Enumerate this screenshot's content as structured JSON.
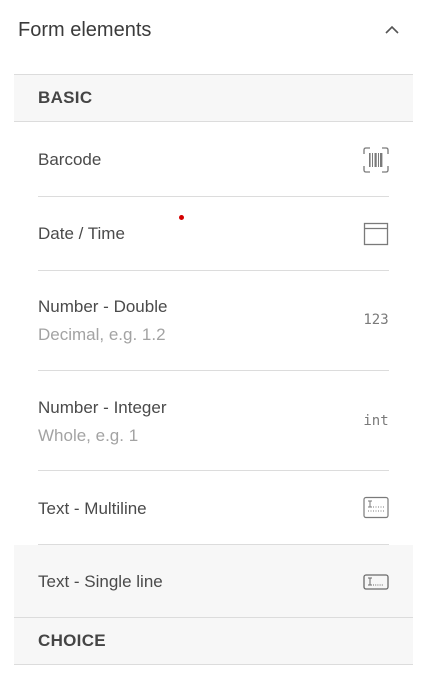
{
  "panel": {
    "title": "Form elements"
  },
  "sections": {
    "basic": "BASIC",
    "choice": "CHOICE"
  },
  "items": [
    {
      "title": "Barcode",
      "subtitle": "",
      "icon": "barcode-icon"
    },
    {
      "title": "Date / Time",
      "subtitle": "",
      "icon": "calendar-icon"
    },
    {
      "title": "Number - Double",
      "subtitle": "Decimal, e.g. 1.2",
      "icon": "number-double-icon",
      "icon_text": "123"
    },
    {
      "title": "Number - Integer",
      "subtitle": "Whole, e.g. 1",
      "icon": "number-integer-icon",
      "icon_text": "int"
    },
    {
      "title": "Text - Multiline",
      "subtitle": "",
      "icon": "text-multiline-icon"
    },
    {
      "title": "Text - Single line",
      "subtitle": "",
      "icon": "text-single-line-icon"
    }
  ],
  "colors": {
    "section_bg": "#f7f7f7",
    "divider": "#dcdcdc",
    "marker": "#d40000"
  }
}
